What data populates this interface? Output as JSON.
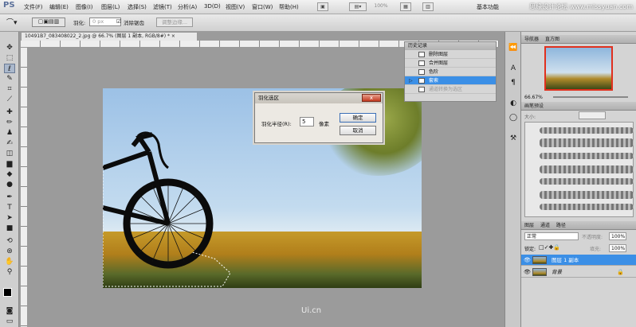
{
  "app": {
    "logo": "PS"
  },
  "menubar": {
    "items": [
      "文件(F)",
      "编辑(E)",
      "图像(I)",
      "图层(L)",
      "选择(S)",
      "滤镜(T)",
      "分析(A)",
      "3D(D)",
      "视图(V)",
      "窗口(W)",
      "帮助(H)"
    ],
    "zoom": "100%",
    "workspace": "基本功能",
    "watermark": "思缘设计论坛 www.missyuan.com"
  },
  "options": {
    "feather_label": "羽化:",
    "feather_value": "0 px",
    "antialias_label": "消除锯齿",
    "refine_button": "调整边缘..."
  },
  "document": {
    "tab_title": "10491B7_083408022_2.jpg @ 66.7% (图层 1 副本, RGB/8#) * ×"
  },
  "feather_dialog": {
    "title": "羽化选区",
    "radius_label": "羽化半径(R):",
    "radius_value": "5",
    "unit": "像素",
    "ok": "确定",
    "cancel": "取消",
    "close": "x"
  },
  "history": {
    "title": "历史记录",
    "rows": [
      "删除图层",
      "合并图层",
      "色阶",
      "套索",
      "通道转换为选区"
    ]
  },
  "navigator": {
    "tabs": [
      "导航器",
      "直方图"
    ],
    "zoom": "66.67%"
  },
  "brushes": {
    "title": "画笔预设",
    "size_label": "大小:"
  },
  "layers": {
    "tabs": [
      "图层",
      "通道",
      "路径"
    ],
    "blend_mode": "正常",
    "opacity_label": "不透明度:",
    "opacity": "100%",
    "lock_label": "锁定:",
    "fill_label": "填充:",
    "fill": "100%",
    "rows": [
      {
        "name": "图层 1 副本",
        "selected": true
      },
      {
        "name": "背景",
        "selected": false
      }
    ]
  },
  "footer_watermark": "Ui.cn",
  "colors": {
    "selection_blue": "#3b8fe6",
    "close_red": "#c43a20"
  }
}
